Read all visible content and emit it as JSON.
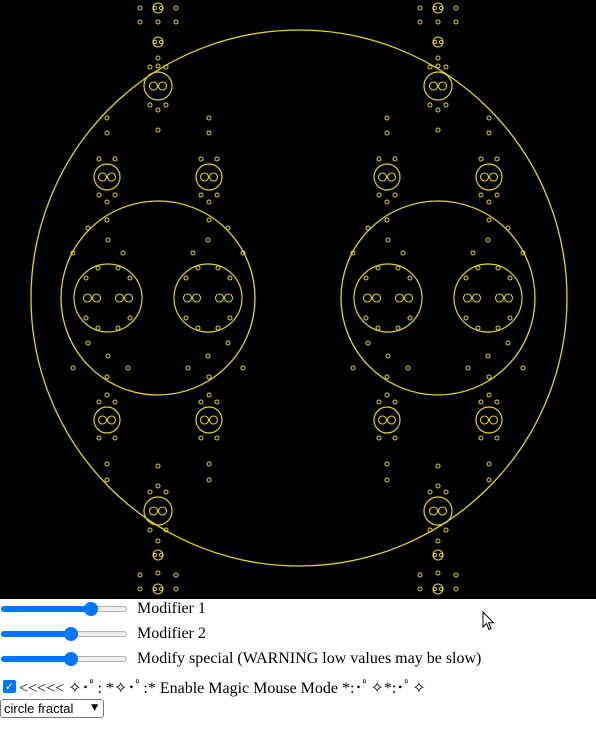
{
  "canvas": {
    "background": "#000000",
    "stroke_color": "#e6d41e"
  },
  "controls": {
    "slider_color": "#0075ff",
    "sliders": [
      {
        "label": "Modifier 1",
        "value": 0.74
      },
      {
        "label": "Modifier 2",
        "value": 0.56
      },
      {
        "label": "Modify special (WARNING low values may be slow)",
        "value": 0.56
      }
    ],
    "magic_mouse": {
      "checked": true,
      "label": "<<<<< ✧･ﾟ: *✧･ﾟ:* Enable Magic Mouse Mode *:･ﾟ✧*:･ﾟ✧"
    },
    "mode_select": {
      "selected": "circle fractal"
    }
  },
  "icons": {
    "checkmark": "check-icon",
    "dropdown": "chevron-down-icon",
    "cursor": "mouse-pointer-icon"
  }
}
